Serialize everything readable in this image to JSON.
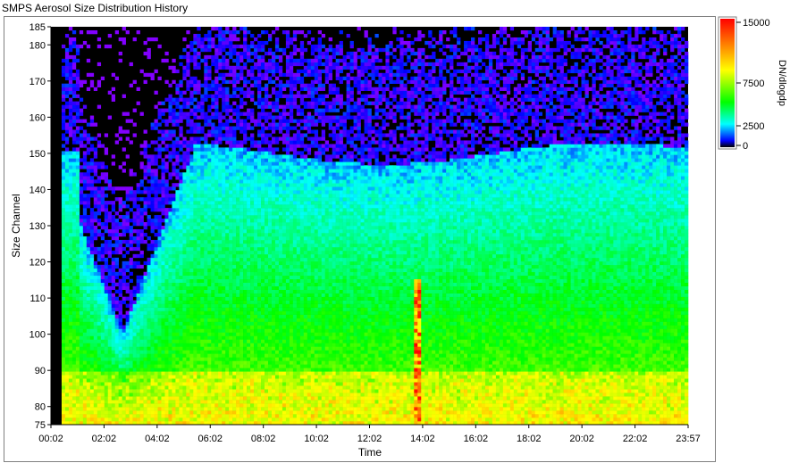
{
  "window": {
    "title": "SMPS Aerosol Size Distribution History"
  },
  "chart_data": {
    "type": "heatmap",
    "title": "SMPS Aerosol Size Distribution History",
    "xlabel": "Time",
    "ylabel": "Size Channel",
    "x_ticks": [
      "00:02",
      "02:02",
      "04:02",
      "06:02",
      "08:02",
      "10:02",
      "12:02",
      "14:02",
      "16:02",
      "18:02",
      "20:02",
      "22:02",
      "23:57"
    ],
    "y_ticks": [
      75,
      80,
      90,
      100,
      110,
      120,
      130,
      140,
      150,
      160,
      170,
      180,
      185
    ],
    "ylim": [
      75,
      185
    ],
    "colorbar": {
      "label": "DN/dlogdp",
      "ticks": [
        {
          "label": "15000",
          "value": 15000
        },
        {
          "label": "7500",
          "value": 7500
        },
        {
          "label": "2500",
          "value": 2500
        },
        {
          "label": "0",
          "value": 0
        }
      ],
      "colors": [
        "#000000",
        "#0000ff",
        "#00ffff",
        "#00ff00",
        "#ffff00",
        "#ff0000"
      ]
    },
    "features": {
      "background_color": "#000000",
      "low_concentration_color": "#9900ff",
      "mid_concentration_color": "#00ffff",
      "high_concentration_color": "#00ff00",
      "peak_event_time": "13:42",
      "peak_event_channels": [
        75,
        115
      ]
    }
  }
}
